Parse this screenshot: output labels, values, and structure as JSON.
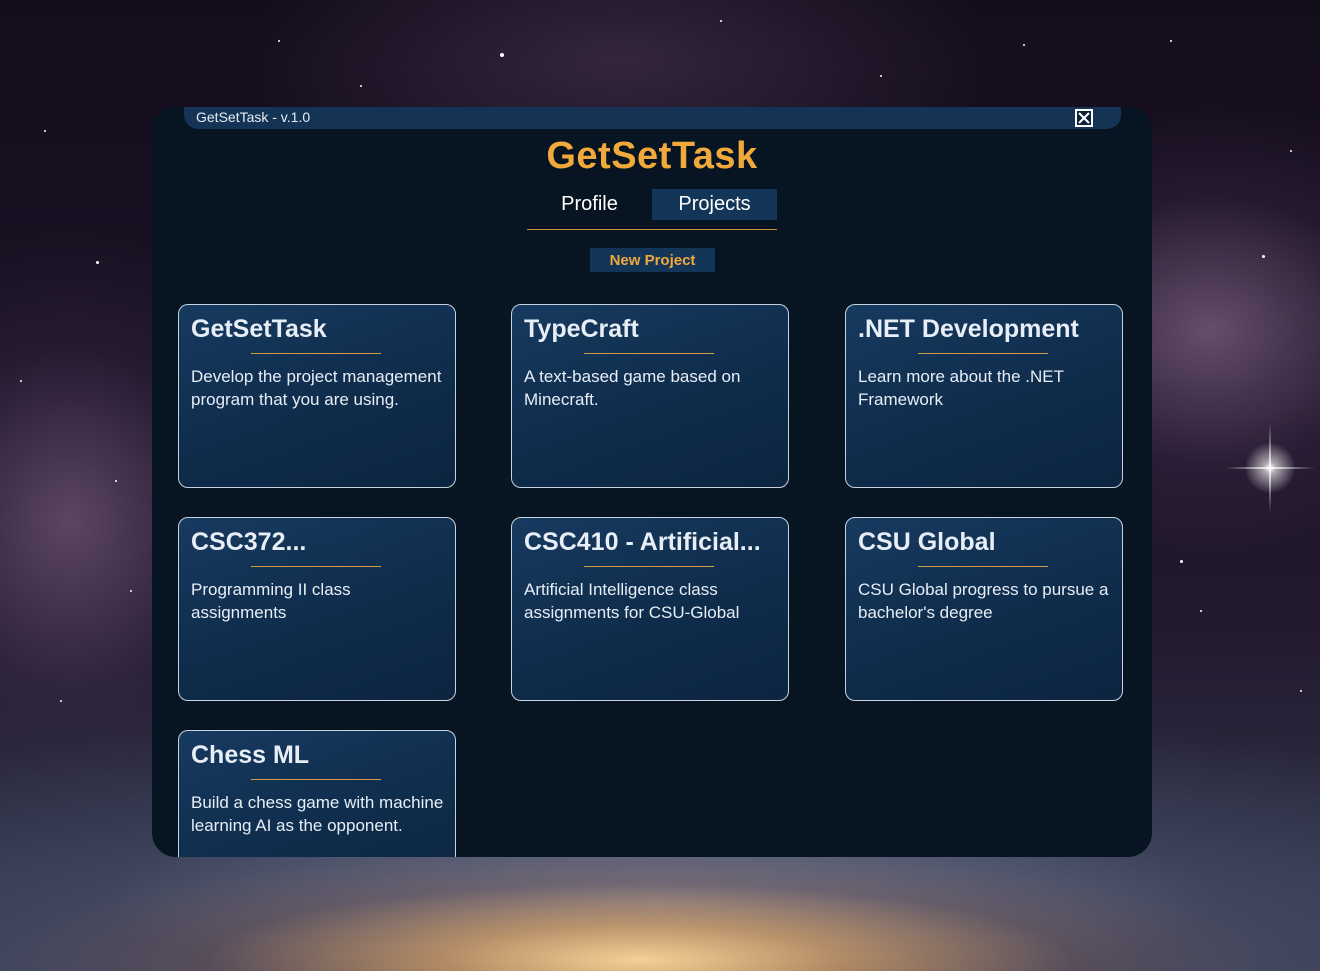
{
  "window": {
    "title_bar_text": "GetSetTask - v.1.0",
    "app_title": "GetSetTask"
  },
  "tabs": [
    {
      "label": "Profile",
      "active": false
    },
    {
      "label": "Projects",
      "active": true
    }
  ],
  "actions": {
    "new_project_label": "New Project"
  },
  "icons": {
    "close": "close-icon"
  },
  "colors": {
    "accent": "#f2a93b",
    "window_bg": "#061521",
    "card_bg": "#123356",
    "tab_active_bg": "#133658",
    "title_bar_bg": "#143355"
  },
  "projects": [
    {
      "title": "GetSetTask",
      "description": "Develop the project management program that you are using."
    },
    {
      "title": "TypeCraft",
      "description": "A text-based game based on Minecraft."
    },
    {
      "title": ".NET Development",
      "description": "Learn more about the .NET Framework"
    },
    {
      "title": "CSC372...",
      "description": "Programming II class assignments"
    },
    {
      "title": "CSC410 - Artificial...",
      "description": "Artificial Intelligence class assignments for CSU-Global"
    },
    {
      "title": "CSU Global",
      "description": "CSU Global progress to pursue a bachelor's degree"
    },
    {
      "title": "Chess ML",
      "description": "Build a chess game with machine learning AI as the opponent."
    }
  ]
}
